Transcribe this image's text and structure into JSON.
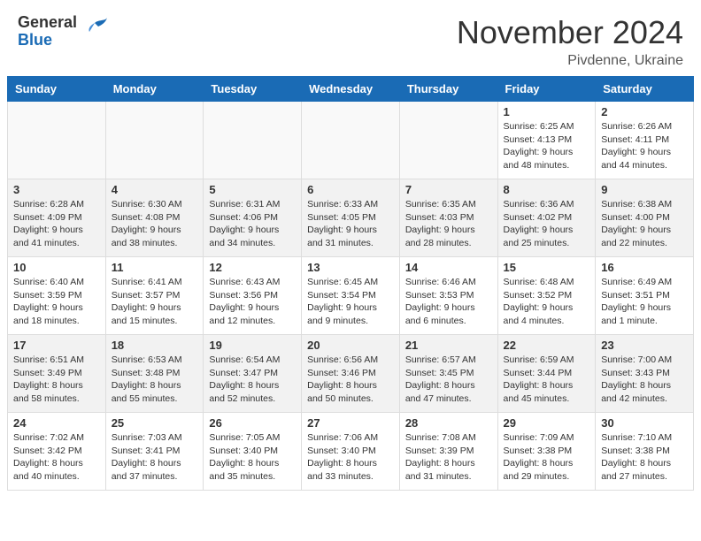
{
  "header": {
    "logo_general": "General",
    "logo_blue": "Blue",
    "month_title": "November 2024",
    "location": "Pivdenne, Ukraine"
  },
  "weekdays": [
    "Sunday",
    "Monday",
    "Tuesday",
    "Wednesday",
    "Thursday",
    "Friday",
    "Saturday"
  ],
  "weeks": [
    [
      {
        "day": "",
        "sunrise": "",
        "sunset": "",
        "daylight": "",
        "empty": true
      },
      {
        "day": "",
        "sunrise": "",
        "sunset": "",
        "daylight": "",
        "empty": true
      },
      {
        "day": "",
        "sunrise": "",
        "sunset": "",
        "daylight": "",
        "empty": true
      },
      {
        "day": "",
        "sunrise": "",
        "sunset": "",
        "daylight": "",
        "empty": true
      },
      {
        "day": "",
        "sunrise": "",
        "sunset": "",
        "daylight": "",
        "empty": true
      },
      {
        "day": "1",
        "sunrise": "Sunrise: 6:25 AM",
        "sunset": "Sunset: 4:13 PM",
        "daylight": "Daylight: 9 hours and 48 minutes.",
        "empty": false
      },
      {
        "day": "2",
        "sunrise": "Sunrise: 6:26 AM",
        "sunset": "Sunset: 4:11 PM",
        "daylight": "Daylight: 9 hours and 44 minutes.",
        "empty": false
      }
    ],
    [
      {
        "day": "3",
        "sunrise": "Sunrise: 6:28 AM",
        "sunset": "Sunset: 4:09 PM",
        "daylight": "Daylight: 9 hours and 41 minutes.",
        "empty": false
      },
      {
        "day": "4",
        "sunrise": "Sunrise: 6:30 AM",
        "sunset": "Sunset: 4:08 PM",
        "daylight": "Daylight: 9 hours and 38 minutes.",
        "empty": false
      },
      {
        "day": "5",
        "sunrise": "Sunrise: 6:31 AM",
        "sunset": "Sunset: 4:06 PM",
        "daylight": "Daylight: 9 hours and 34 minutes.",
        "empty": false
      },
      {
        "day": "6",
        "sunrise": "Sunrise: 6:33 AM",
        "sunset": "Sunset: 4:05 PM",
        "daylight": "Daylight: 9 hours and 31 minutes.",
        "empty": false
      },
      {
        "day": "7",
        "sunrise": "Sunrise: 6:35 AM",
        "sunset": "Sunset: 4:03 PM",
        "daylight": "Daylight: 9 hours and 28 minutes.",
        "empty": false
      },
      {
        "day": "8",
        "sunrise": "Sunrise: 6:36 AM",
        "sunset": "Sunset: 4:02 PM",
        "daylight": "Daylight: 9 hours and 25 minutes.",
        "empty": false
      },
      {
        "day": "9",
        "sunrise": "Sunrise: 6:38 AM",
        "sunset": "Sunset: 4:00 PM",
        "daylight": "Daylight: 9 hours and 22 minutes.",
        "empty": false
      }
    ],
    [
      {
        "day": "10",
        "sunrise": "Sunrise: 6:40 AM",
        "sunset": "Sunset: 3:59 PM",
        "daylight": "Daylight: 9 hours and 18 minutes.",
        "empty": false
      },
      {
        "day": "11",
        "sunrise": "Sunrise: 6:41 AM",
        "sunset": "Sunset: 3:57 PM",
        "daylight": "Daylight: 9 hours and 15 minutes.",
        "empty": false
      },
      {
        "day": "12",
        "sunrise": "Sunrise: 6:43 AM",
        "sunset": "Sunset: 3:56 PM",
        "daylight": "Daylight: 9 hours and 12 minutes.",
        "empty": false
      },
      {
        "day": "13",
        "sunrise": "Sunrise: 6:45 AM",
        "sunset": "Sunset: 3:54 PM",
        "daylight": "Daylight: 9 hours and 9 minutes.",
        "empty": false
      },
      {
        "day": "14",
        "sunrise": "Sunrise: 6:46 AM",
        "sunset": "Sunset: 3:53 PM",
        "daylight": "Daylight: 9 hours and 6 minutes.",
        "empty": false
      },
      {
        "day": "15",
        "sunrise": "Sunrise: 6:48 AM",
        "sunset": "Sunset: 3:52 PM",
        "daylight": "Daylight: 9 hours and 4 minutes.",
        "empty": false
      },
      {
        "day": "16",
        "sunrise": "Sunrise: 6:49 AM",
        "sunset": "Sunset: 3:51 PM",
        "daylight": "Daylight: 9 hours and 1 minute.",
        "empty": false
      }
    ],
    [
      {
        "day": "17",
        "sunrise": "Sunrise: 6:51 AM",
        "sunset": "Sunset: 3:49 PM",
        "daylight": "Daylight: 8 hours and 58 minutes.",
        "empty": false
      },
      {
        "day": "18",
        "sunrise": "Sunrise: 6:53 AM",
        "sunset": "Sunset: 3:48 PM",
        "daylight": "Daylight: 8 hours and 55 minutes.",
        "empty": false
      },
      {
        "day": "19",
        "sunrise": "Sunrise: 6:54 AM",
        "sunset": "Sunset: 3:47 PM",
        "daylight": "Daylight: 8 hours and 52 minutes.",
        "empty": false
      },
      {
        "day": "20",
        "sunrise": "Sunrise: 6:56 AM",
        "sunset": "Sunset: 3:46 PM",
        "daylight": "Daylight: 8 hours and 50 minutes.",
        "empty": false
      },
      {
        "day": "21",
        "sunrise": "Sunrise: 6:57 AM",
        "sunset": "Sunset: 3:45 PM",
        "daylight": "Daylight: 8 hours and 47 minutes.",
        "empty": false
      },
      {
        "day": "22",
        "sunrise": "Sunrise: 6:59 AM",
        "sunset": "Sunset: 3:44 PM",
        "daylight": "Daylight: 8 hours and 45 minutes.",
        "empty": false
      },
      {
        "day": "23",
        "sunrise": "Sunrise: 7:00 AM",
        "sunset": "Sunset: 3:43 PM",
        "daylight": "Daylight: 8 hours and 42 minutes.",
        "empty": false
      }
    ],
    [
      {
        "day": "24",
        "sunrise": "Sunrise: 7:02 AM",
        "sunset": "Sunset: 3:42 PM",
        "daylight": "Daylight: 8 hours and 40 minutes.",
        "empty": false
      },
      {
        "day": "25",
        "sunrise": "Sunrise: 7:03 AM",
        "sunset": "Sunset: 3:41 PM",
        "daylight": "Daylight: 8 hours and 37 minutes.",
        "empty": false
      },
      {
        "day": "26",
        "sunrise": "Sunrise: 7:05 AM",
        "sunset": "Sunset: 3:40 PM",
        "daylight": "Daylight: 8 hours and 35 minutes.",
        "empty": false
      },
      {
        "day": "27",
        "sunrise": "Sunrise: 7:06 AM",
        "sunset": "Sunset: 3:40 PM",
        "daylight": "Daylight: 8 hours and 33 minutes.",
        "empty": false
      },
      {
        "day": "28",
        "sunrise": "Sunrise: 7:08 AM",
        "sunset": "Sunset: 3:39 PM",
        "daylight": "Daylight: 8 hours and 31 minutes.",
        "empty": false
      },
      {
        "day": "29",
        "sunrise": "Sunrise: 7:09 AM",
        "sunset": "Sunset: 3:38 PM",
        "daylight": "Daylight: 8 hours and 29 minutes.",
        "empty": false
      },
      {
        "day": "30",
        "sunrise": "Sunrise: 7:10 AM",
        "sunset": "Sunset: 3:38 PM",
        "daylight": "Daylight: 8 hours and 27 minutes.",
        "empty": false
      }
    ]
  ]
}
